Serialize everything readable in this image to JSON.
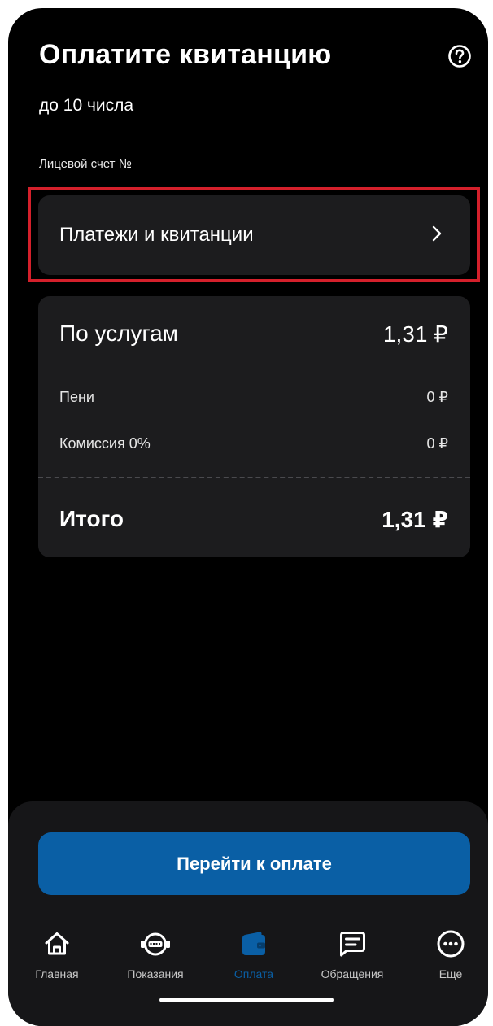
{
  "header": {
    "title": "Оплатите квитанцию",
    "subtitle": "до 10 числа",
    "account_label": "Лицевой счет №",
    "help_icon": "question-circle-icon"
  },
  "payments_link": {
    "label": "Платежи и квитанции",
    "icon": "chevron-right-icon",
    "highlight_color": "#d4202b"
  },
  "summary": {
    "services_label": "По услугам",
    "services_value": "1,31 ₽",
    "penalties_label": "Пени",
    "penalties_value": "0 ₽",
    "commission_label": "Комиссия 0%",
    "commission_value": "0 ₽",
    "total_label": "Итого",
    "total_value": "1,31 ₽"
  },
  "actions": {
    "pay_button_label": "Перейти к оплате",
    "accent_color": "#0a5fa5"
  },
  "bottom_nav": {
    "items": [
      {
        "label": "Главная",
        "icon": "home-icon",
        "active": false
      },
      {
        "label": "Показания",
        "icon": "meter-icon",
        "active": false
      },
      {
        "label": "Оплата",
        "icon": "wallet-icon",
        "active": true
      },
      {
        "label": "Обращения",
        "icon": "message-icon",
        "active": false
      },
      {
        "label": "Еще",
        "icon": "more-icon",
        "active": false
      }
    ]
  }
}
